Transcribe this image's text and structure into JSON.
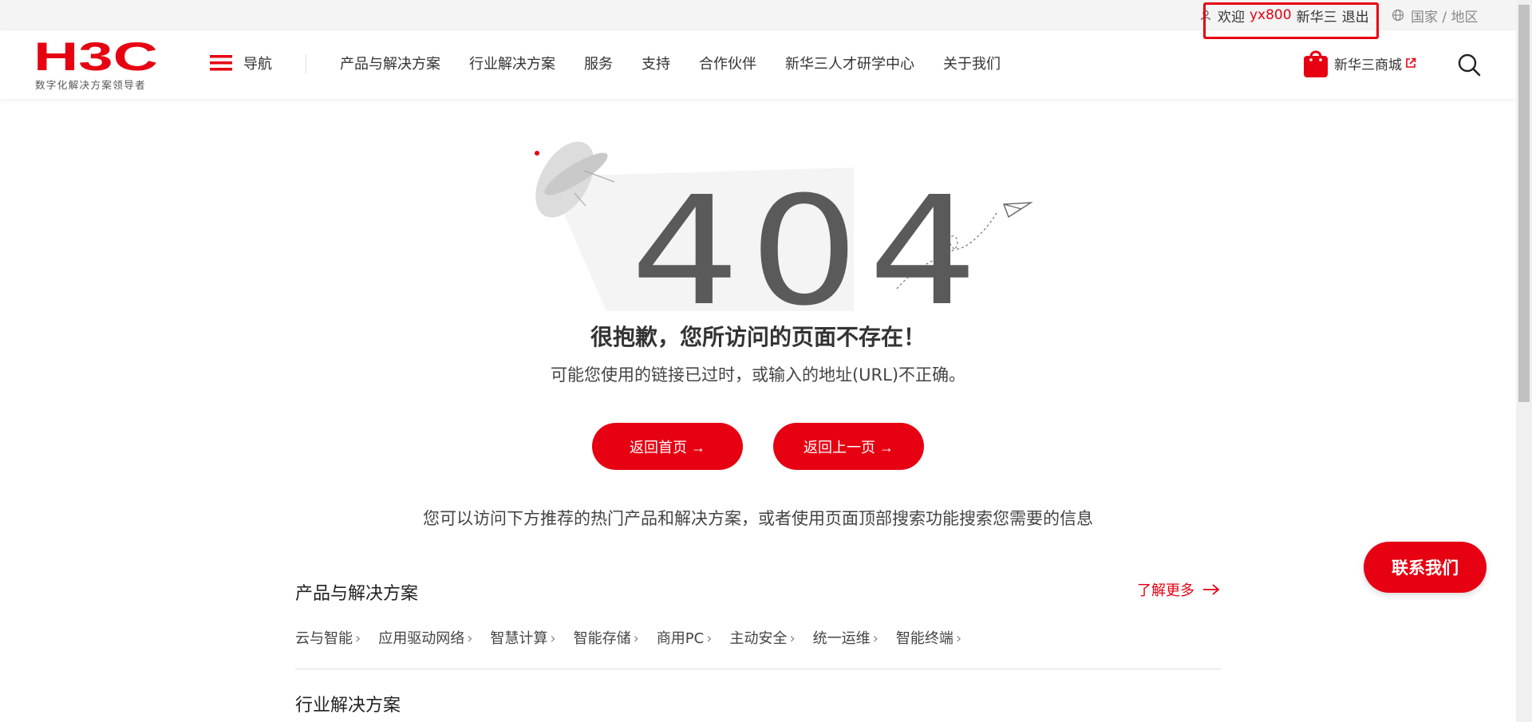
{
  "topbar": {
    "welcome": "欢迎",
    "username": "yx800",
    "company": "新华三",
    "logout": "退出",
    "region": "国家 / 地区"
  },
  "brand": {
    "logo_text": "H3C",
    "tagline": "数字化解决方案领导者",
    "accent_color": "#e60012"
  },
  "header": {
    "nav_toggle": "导航",
    "nav_links": [
      "产品与解决方案",
      "行业解决方案",
      "服务",
      "支持",
      "合作伙伴",
      "新华三人才研学中心",
      "关于我们"
    ],
    "shop_label": "新华三商城"
  },
  "error": {
    "code": "404",
    "title": "很抱歉，您所访问的页面不存在！",
    "subtitle": "可能您使用的链接已过时，或输入的地址(URL)不正确。",
    "btn_home": "返回首页 →",
    "btn_back": "返回上一页 →",
    "hint": "您可以访问下方推荐的热门产品和解决方案，或者使用页面顶部搜索功能搜索您需要的信息"
  },
  "sections": {
    "products_title": "产品与解决方案",
    "more_label": "了解更多",
    "categories": [
      "云与智能",
      "应用驱动网络",
      "智慧计算",
      "智能存储",
      "商用PC",
      "主动安全",
      "统一运维",
      "智能终端"
    ],
    "industry_title": "行业解决方案"
  },
  "contact": {
    "label": "联系我们"
  },
  "icons": [
    "user-icon",
    "globe-icon",
    "menu-icon",
    "bag-icon",
    "external-link-icon",
    "search-icon",
    "arrow-right-icon",
    "ufo-icon",
    "paper-plane-icon"
  ]
}
